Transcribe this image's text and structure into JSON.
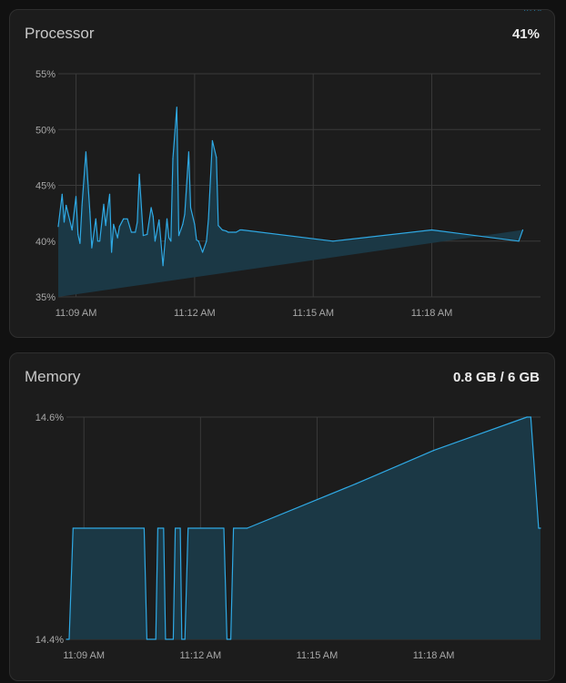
{
  "processor": {
    "title": "Processor",
    "value": "41%"
  },
  "memory": {
    "title": "Memory",
    "value": "0.8 GB / 6 GB"
  },
  "colors": {
    "line": "#2fa9e4",
    "fill": "#1b3845",
    "grid": "#3a3a3a",
    "card": "#1c1c1c"
  },
  "chart_data": [
    {
      "type": "area",
      "title": "Processor",
      "ylabel": "",
      "xlabel": "",
      "ylim": [
        35,
        55
      ],
      "yticks": [
        35,
        40,
        45,
        50,
        55
      ],
      "ytick_labels": [
        "35%",
        "40%",
        "45%",
        "50%",
        "55%"
      ],
      "xlim": [
        8.55,
        20.75
      ],
      "xticks": [
        9,
        12,
        15,
        18
      ],
      "xtick_labels": [
        "11:09 AM",
        "11:12 AM",
        "11:15 AM",
        "11:18 AM"
      ],
      "grid": true,
      "x_unit": "minutes past 11:00",
      "x": [
        8.55,
        8.65,
        8.7,
        8.75,
        8.9,
        9.0,
        9.05,
        9.1,
        9.15,
        9.25,
        9.35,
        9.4,
        9.5,
        9.55,
        9.6,
        9.7,
        9.75,
        9.85,
        9.9,
        9.95,
        10.05,
        10.1,
        10.2,
        10.3,
        10.4,
        10.5,
        10.55,
        10.6,
        10.7,
        10.8,
        10.9,
        10.95,
        11.0,
        11.1,
        11.2,
        11.3,
        11.35,
        11.4,
        11.45,
        11.55,
        11.6,
        11.7,
        11.75,
        11.85,
        11.9,
        12.0,
        12.05,
        12.1,
        12.2,
        12.3,
        12.35,
        12.45,
        12.55,
        12.6,
        12.7,
        12.8,
        12.85,
        12.95,
        13.0,
        13.05,
        13.15,
        13.2,
        15.5,
        18.0,
        20.2,
        20.3,
        20.35,
        20.42,
        20.5,
        20.6,
        20.7,
        20.75
      ],
      "y": [
        41.3,
        44.2,
        41.7,
        43.2,
        41.0,
        44.0,
        40.6,
        39.8,
        43.2,
        48.0,
        42.6,
        39.4,
        42.0,
        40.0,
        40.0,
        43.3,
        41.4,
        44.2,
        39.0,
        41.5,
        40.3,
        41.3,
        42.0,
        42.0,
        40.8,
        40.8,
        41.7,
        46.0,
        40.5,
        40.6,
        43.0,
        42.2,
        40.0,
        41.9,
        37.8,
        42.0,
        40.3,
        40.0,
        47.4,
        52.0,
        40.5,
        41.5,
        42.4,
        48.0,
        43.0,
        41.5,
        40.1,
        40.0,
        39.0,
        40.0,
        42.0,
        49.0,
        47.5,
        41.4,
        41.0,
        40.9,
        40.8,
        40.8,
        40.8,
        40.8,
        41.0,
        41.0,
        40.0,
        41.0,
        40.0,
        41.0
      ]
    },
    {
      "type": "area",
      "title": "Memory",
      "ylabel": "",
      "xlabel": "",
      "ylim": [
        14.4,
        14.6
      ],
      "yticks": [
        14.4,
        14.6
      ],
      "ytick_labels": [
        "14.4%",
        "14.6%"
      ],
      "xlim": [
        8.55,
        20.75
      ],
      "xticks": [
        9,
        12,
        15,
        18
      ],
      "xtick_labels": [
        "11:09 AM",
        "11:12 AM",
        "11:15 AM",
        "11:18 AM"
      ],
      "grid": true,
      "x_unit": "minutes past 11:00",
      "x": [
        8.55,
        8.62,
        8.72,
        10.55,
        10.62,
        10.85,
        10.9,
        11.05,
        11.1,
        11.3,
        11.35,
        11.48,
        11.52,
        11.6,
        11.68,
        12.6,
        12.68,
        12.78,
        12.85,
        13.2,
        16.0,
        18.0,
        20.4,
        20.5,
        20.7,
        20.75
      ],
      "y": [
        14.4,
        14.4,
        14.5,
        14.5,
        14.4,
        14.4,
        14.5,
        14.5,
        14.4,
        14.4,
        14.5,
        14.5,
        14.4,
        14.4,
        14.5,
        14.5,
        14.4,
        14.4,
        14.5,
        14.5,
        14.54,
        14.57,
        14.6,
        14.6,
        14.5,
        14.5
      ]
    }
  ]
}
